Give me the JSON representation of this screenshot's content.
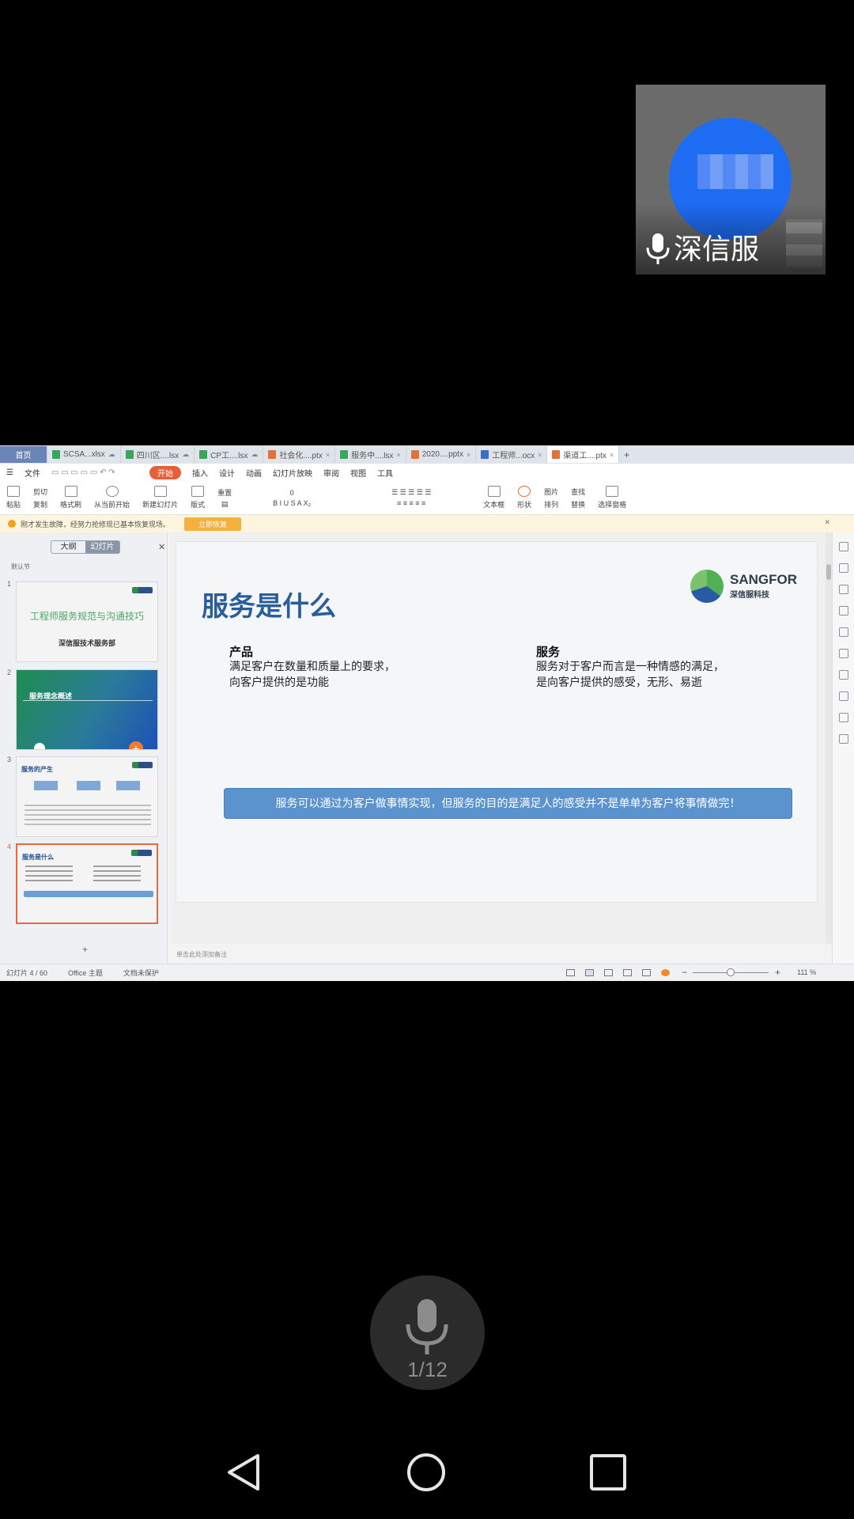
{
  "speaker": {
    "name": "深信服",
    "icons": {
      "mic": "microphone-icon"
    }
  },
  "tabs": [
    {
      "label": "首页",
      "type": "home"
    },
    {
      "label": "SCSA...xlsx",
      "color": "#3aa65a"
    },
    {
      "label": "四川区....lsx",
      "color": "#3aa65a"
    },
    {
      "label": "CP工....lsx",
      "color": "#3aa65a"
    },
    {
      "label": "社会化....ptx",
      "color": "#e0733a"
    },
    {
      "label": "服务中....lsx",
      "color": "#3aa65a"
    },
    {
      "label": "2020....pptx",
      "color": "#e0733a"
    },
    {
      "label": "工程师...ocx",
      "color": "#3a6ec9"
    },
    {
      "label": "渠道工....ptx",
      "color": "#e0733a",
      "active": true
    }
  ],
  "menu": {
    "file": "文件",
    "start": "开始",
    "items": [
      "插入",
      "设计",
      "动画",
      "幻灯片放映",
      "审阅",
      "视图",
      "工具"
    ]
  },
  "ribbon": {
    "paste": "粘贴",
    "cut": "剪切",
    "copy": "复制",
    "format_painter": "格式刷",
    "from_current": "从当前开始",
    "new_slide": "新建幻灯片",
    "layout": "版式",
    "reset": "重置",
    "font_size": "0",
    "textbox": "文本框",
    "shape": "形状",
    "picture": "图片",
    "arrange": "排列",
    "find": "查找",
    "replace": "替换",
    "select_pane": "选择窗格"
  },
  "notice": {
    "text": "刚才发生故障，经努力抢修现已基本恢复现场。",
    "button": "立即恢复"
  },
  "left_pane": {
    "tab_outline": "大纲",
    "tab_slides": "幻灯片",
    "section": "默认节",
    "thumbnails": [
      {
        "num": "1",
        "title": "工程师服务规范与沟通技巧",
        "subtitle": "深信服技术服务部"
      },
      {
        "num": "2",
        "title": "服务理念概述"
      },
      {
        "num": "3",
        "title": "服务的产生"
      },
      {
        "num": "4",
        "title": "服务是什么",
        "selected": true
      }
    ],
    "add_symbol": "+"
  },
  "slide": {
    "title": "服务是什么",
    "logo_en": "SANGFOR",
    "logo_cn": "深信服科技",
    "left_heading": "产品",
    "left_line1": "满足客户在数量和质量上的要求，",
    "left_line2": "向客户提供的是功能",
    "right_heading": "服务",
    "right_line1": "服务对于客户而言是一种情感的满足，",
    "right_line2": "是向客户提供的感受，无形、易逝",
    "banner": "服务可以通过为客户做事情实现，但服务的目的是满足人的感受并不是单单为客户将事情做完！"
  },
  "notes_placeholder": "单击此处添加备注",
  "status": {
    "slide_count": "幻灯片 4 / 60",
    "theme": "Office 主题",
    "protection": "文档未保护",
    "zoom": "111 %",
    "zoom_fraction": 0.5
  },
  "call": {
    "participants": "1/12"
  },
  "colors": {
    "accent": "#e85d3a",
    "slide_title": "#2b5d9b",
    "banner": "#5b93cf"
  }
}
